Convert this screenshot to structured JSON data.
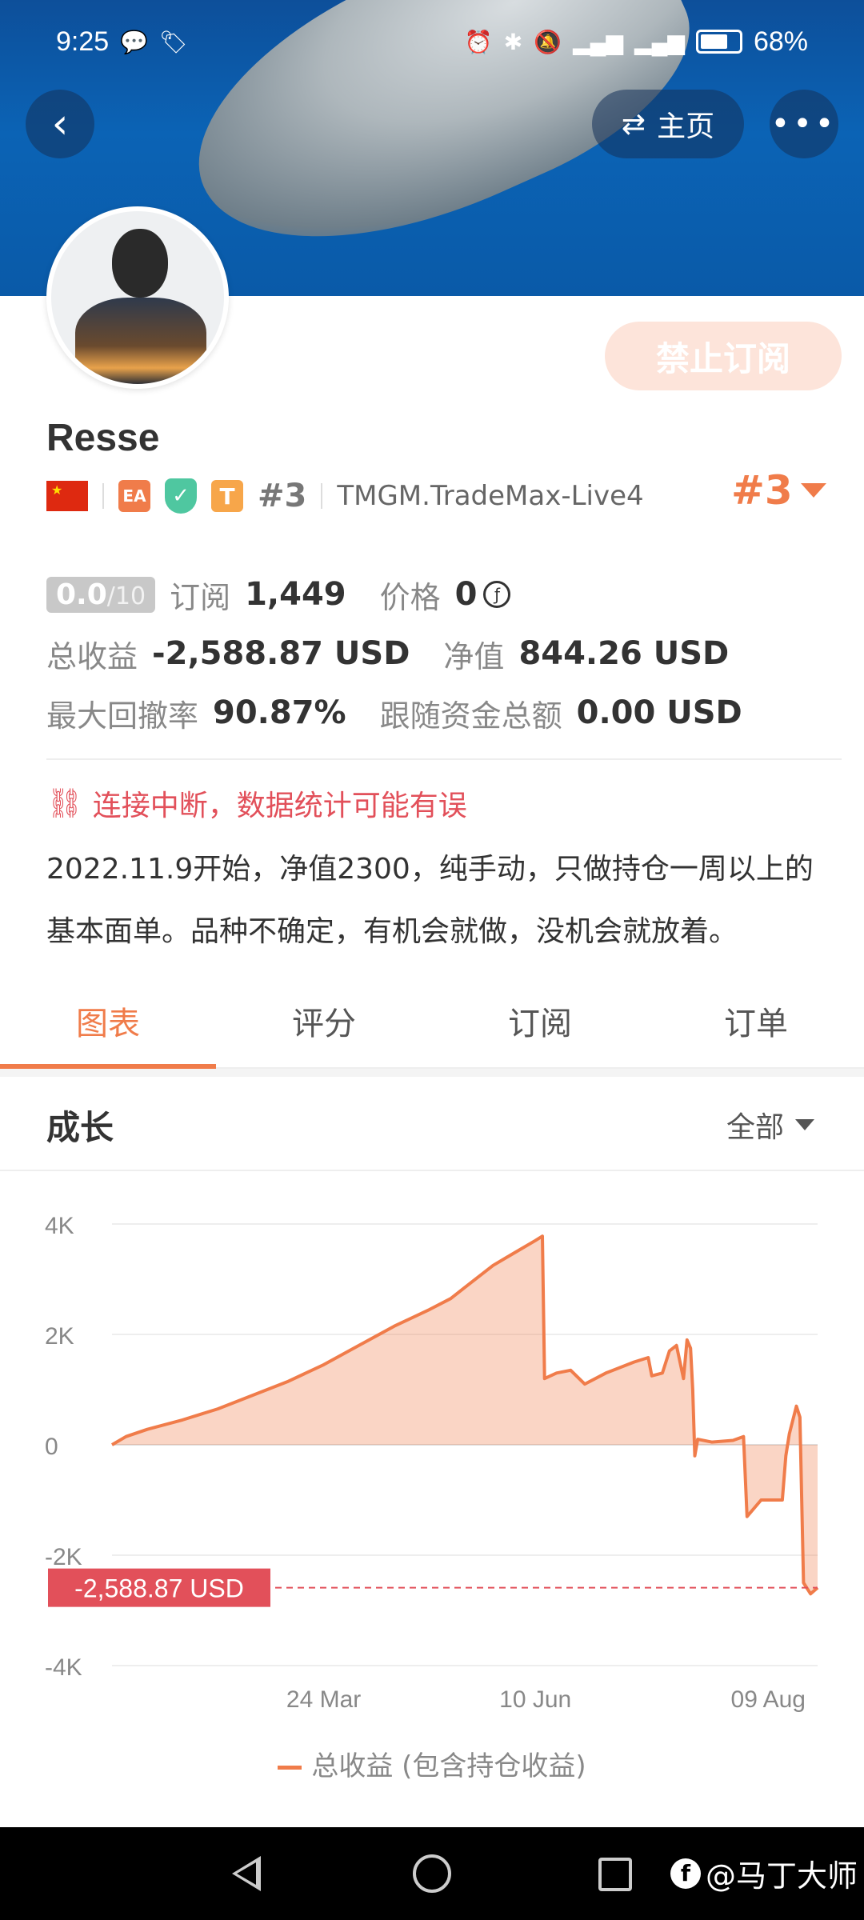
{
  "status_bar": {
    "time": "9:25",
    "battery": "68%",
    "battery_level": 0.68
  },
  "header": {
    "back_icon": "chevron-left-icon",
    "home_label": "主页",
    "more_icon": "more-horizontal-icon"
  },
  "profile": {
    "name": "Resse",
    "subscribe_button": "禁止订阅",
    "badges": {
      "ea": "EA",
      "t": "T",
      "rank_small": "#3",
      "server": "TMGM.TradeMax-Live4"
    },
    "rank": "#3"
  },
  "stats": {
    "score": "0.0",
    "score_max": "/10",
    "subscribe_label": "订阅",
    "subscribe_count": "1,449",
    "price_label": "价格",
    "price_value": "0",
    "total_profit_label": "总收益",
    "total_profit_value": "-2,588.87 USD",
    "equity_label": "净值",
    "equity_value": "844.26 USD",
    "drawdown_label": "最大回撤率",
    "drawdown_value": "90.87%",
    "follow_funds_label": "跟随资金总额",
    "follow_funds_value": "0.00 USD"
  },
  "warning": "连接中断，数据统计可能有误",
  "description": "2022.11.9开始，净值2300，纯手动，只做持仓一周以上的基本面单。品种不确定，有机会就做，没机会就放着。",
  "tabs": [
    {
      "label": "图表",
      "active": true
    },
    {
      "label": "评分",
      "active": false
    },
    {
      "label": "订阅",
      "active": false
    },
    {
      "label": "订单",
      "active": false
    }
  ],
  "section": {
    "title": "成长",
    "range": "全部"
  },
  "chart_data": {
    "type": "area",
    "y_ticks": [
      "4K",
      "2K",
      "0",
      "-2K",
      "-4K"
    ],
    "x_ticks": [
      "24 Mar",
      "10 Jun",
      "09 Aug"
    ],
    "ylim": [
      -4000,
      4000
    ],
    "current_label": "-2,588.87 USD",
    "current_value": -2588.87,
    "legend": "总收益 (包含持仓收益)",
    "color": "#f07c4a",
    "series": [
      {
        "x": [
          0,
          0.02,
          0.05,
          0.1,
          0.15,
          0.2,
          0.25,
          0.3,
          0.35,
          0.4,
          0.45,
          0.48,
          0.5,
          0.54,
          0.56,
          0.58,
          0.6,
          0.61,
          0.613,
          0.63,
          0.65,
          0.67,
          0.7,
          0.74,
          0.76,
          0.765,
          0.78,
          0.79,
          0.8,
          0.81,
          0.815,
          0.82,
          0.823,
          0.826,
          0.83,
          0.85,
          0.88,
          0.895,
          0.9,
          0.92,
          0.95,
          0.955,
          0.96,
          0.97,
          0.975,
          0.98,
          0.99,
          1.0
        ],
        "y": [
          0,
          150,
          280,
          450,
          650,
          900,
          1150,
          1450,
          1800,
          2150,
          2450,
          2650,
          2850,
          3250,
          3400,
          3550,
          3700,
          3780,
          1200,
          1300,
          1350,
          1100,
          1300,
          1500,
          1580,
          1250,
          1300,
          1700,
          1800,
          1200,
          1900,
          1750,
          1000,
          -200,
          100,
          50,
          80,
          150,
          -1300,
          -1000,
          -1000,
          -200,
          200,
          700,
          500,
          -2500,
          -2700,
          -2589
        ]
      }
    ]
  },
  "nav_bar": {
    "watermark": "@马丁大师"
  }
}
